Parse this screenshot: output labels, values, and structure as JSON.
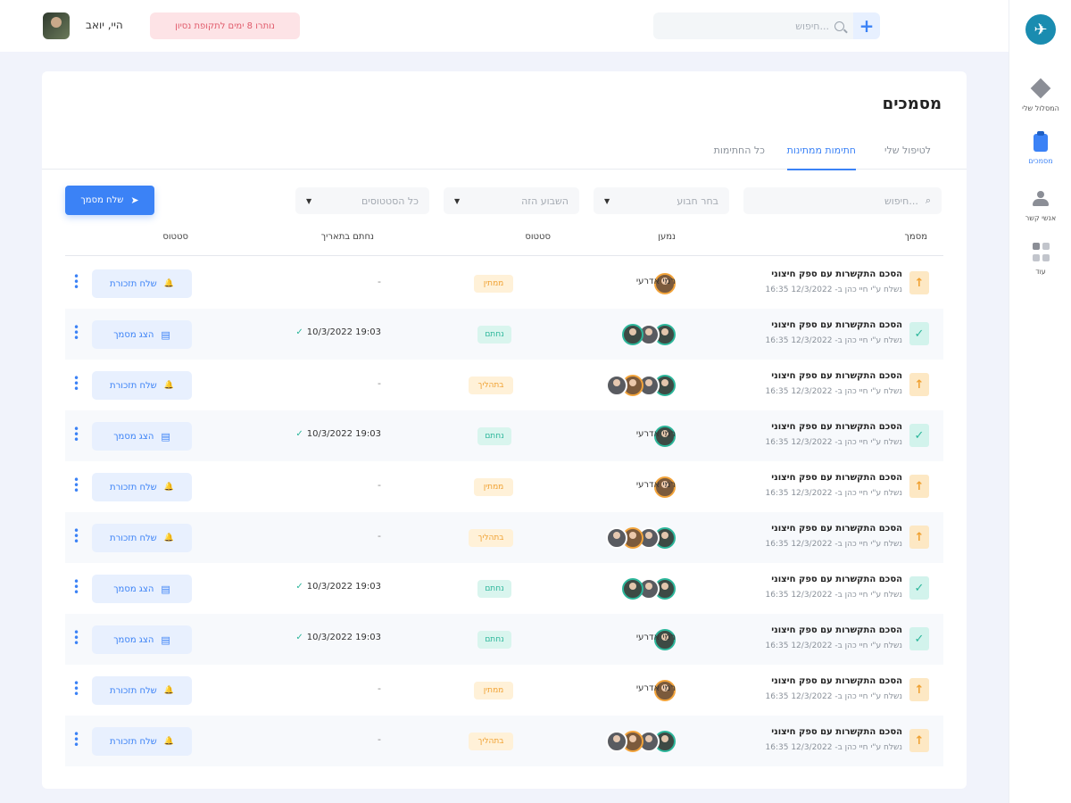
{
  "header": {
    "user_name": "היי, יואב",
    "trial_badge": "נותרו 8 ימים לתקופת נסיון",
    "search_placeholder": "חיפוש...",
    "add_label": "+"
  },
  "sidebar": {
    "logo_glyph": "✈",
    "items": [
      {
        "label": "המסלול שלי"
      },
      {
        "label": "מסמכים"
      },
      {
        "label": "אנשי קשר"
      },
      {
        "label": "עוד"
      }
    ]
  },
  "page": {
    "title": "מסמכים",
    "tabs": [
      {
        "label": "לטיפול שלי"
      },
      {
        "label": "חתימות ממתינות"
      },
      {
        "label": "כל החתימות"
      }
    ],
    "filters": {
      "search_placeholder": "חיפוש...",
      "signer_placeholder": "בחר חבוע",
      "period_value": "השבוע הזה",
      "status_value": "כל הסטטוסים"
    },
    "send_button": "שלח מסמך",
    "columns": {
      "document": "מסמך",
      "signer": "נמען",
      "status": "סטטוס",
      "signed_at": "נחתם בתאריך",
      "actions": "סטטוס"
    }
  },
  "rows": [
    {
      "title": "הסכם התקשרות עם ספק חיצוני",
      "sub": "נשלח ע\"י חיי כהן ב- 12/3/2022 16:35",
      "icon": "up",
      "signer_name": "רמי אדרעי",
      "status": "ממתין",
      "signed_at": "-",
      "action": "שלח תזכורת"
    },
    {
      "title": "הסכם התקשרות עם ספק חיצוני",
      "sub": "נשלח ע\"י חיי כהן ב- 12/3/2022 16:35",
      "icon": "check",
      "signer_name": "",
      "status": "נחתם",
      "signed_at": "10/3/2022 19:03",
      "action": "הצג מסמך"
    },
    {
      "title": "הסכם התקשרות עם ספק חיצוני",
      "sub": "נשלח ע\"י חיי כהן ב- 12/3/2022 16:35",
      "icon": "up",
      "signer_name": "",
      "status": "בתהליך",
      "signed_at": "-",
      "action": "שלח תזכורת"
    },
    {
      "title": "הסכם התקשרות עם ספק חיצוני",
      "sub": "נשלח ע\"י חיי כהן ב- 12/3/2022 16:35",
      "icon": "check",
      "signer_name": "רמי אדרעי",
      "status": "נחתם",
      "signed_at": "10/3/2022 19:03",
      "action": "הצג מסמך"
    },
    {
      "title": "הסכם התקשרות עם ספק חיצוני",
      "sub": "נשלח ע\"י חיי כהן ב- 12/3/2022 16:35",
      "icon": "up",
      "signer_name": "רמי אדרעי",
      "status": "ממתין",
      "signed_at": "-",
      "action": "שלח תזכורת"
    },
    {
      "title": "הסכם התקשרות עם ספק חיצוני",
      "sub": "נשלח ע\"י חיי כהן ב- 12/3/2022 16:35",
      "icon": "up",
      "signer_name": "",
      "status": "בתהליך",
      "signed_at": "-",
      "action": "שלח תזכורת"
    },
    {
      "title": "הסכם התקשרות עם ספק חיצוני",
      "sub": "נשלח ע\"י חיי כהן ב- 12/3/2022 16:35",
      "icon": "check",
      "signer_name": "",
      "status": "נחתם",
      "signed_at": "10/3/2022 19:03",
      "action": "הצג מסמך"
    },
    {
      "title": "הסכם התקשרות עם ספק חיצוני",
      "sub": "נשלח ע\"י חיי כהן ב- 12/3/2022 16:35",
      "icon": "check",
      "signer_name": "רמי אדרעי",
      "status": "נחתם",
      "signed_at": "10/3/2022 19:03",
      "action": "הצג מסמך"
    },
    {
      "title": "הסכם התקשרות עם ספק חיצוני",
      "sub": "נשלח ע\"י חיי כהן ב- 12/3/2022 16:35",
      "icon": "up",
      "signer_name": "רמי אדרעי",
      "status": "ממתין",
      "signed_at": "-",
      "action": "שלח תזכורת"
    },
    {
      "title": "הסכם התקשרות עם ספק חיצוני",
      "sub": "נשלח ע\"י חיי כהן ב- 12/3/2022 16:35",
      "icon": "up",
      "signer_name": "",
      "status": "בתהליך",
      "signed_at": "-",
      "action": "שלח תזכורת"
    }
  ]
}
